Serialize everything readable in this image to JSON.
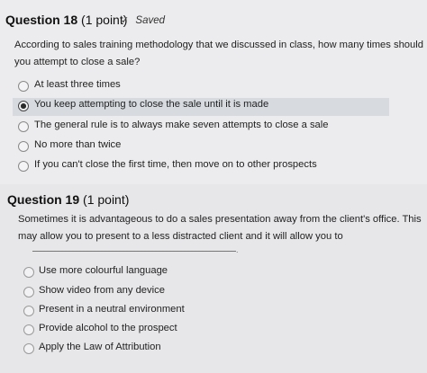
{
  "q18": {
    "title": "Question 18",
    "points": "(1 point)",
    "saved_label": "Saved",
    "prompt_line1": "According to sales training methodology that we discussed in class, how many times should",
    "prompt_line2": "you attempt to close a sale?",
    "options": [
      {
        "label": "At least three times",
        "selected": false
      },
      {
        "label": "You keep attempting to close the sale until it is made",
        "selected": true
      },
      {
        "label": "The general rule is to always make seven attempts to close a sale",
        "selected": false
      },
      {
        "label": "No more than twice",
        "selected": false
      },
      {
        "label": "If you can't close the first time, then move on to other prospects",
        "selected": false
      }
    ]
  },
  "q19": {
    "title": "Question 19",
    "points": "(1 point)",
    "prompt_line1": "Sometimes it is advantageous to do a sales presentation away from the client's office. This",
    "prompt_line2": "may allow you to present to a less distracted client and it will allow you to",
    "blank_end": ".",
    "options": [
      {
        "label": "Use more colourful language",
        "selected": false
      },
      {
        "label": "Show video from any device",
        "selected": false
      },
      {
        "label": "Present in a neutral environment",
        "selected": false
      },
      {
        "label": "Provide alcohol to the prospect",
        "selected": false
      },
      {
        "label": "Apply the Law of Attribution",
        "selected": false
      }
    ]
  },
  "icons": {
    "saved": "checkmark-icon"
  }
}
